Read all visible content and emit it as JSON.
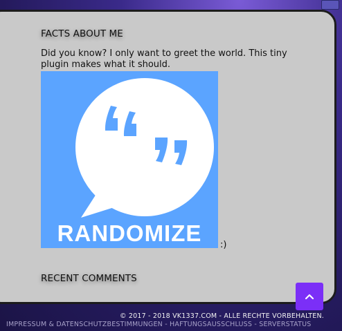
{
  "about": {
    "title": "FACTS ABOUT ME",
    "text": "Did you know? I only want to greet the world. This tiny plugin makes what it should.",
    "image_caption": "RANDOMIZE",
    "after_image": ":)"
  },
  "comments": {
    "title": "RECENT COMMENTS"
  },
  "footer": {
    "copyright": "© 2017 - 2018 VK1337.COM - ALLE RECHTE VORBEHALTEN.",
    "links": [
      "IMPRESSUM & DATENSCHUTZBESTIMMUNGEN",
      "HAFTUNGSAUSSCHLUSS",
      "SERVERSTATUS"
    ],
    "separator": " - "
  },
  "scroll_top": {
    "icon": "chevron-up-icon"
  },
  "colors": {
    "panel": "#c9c9c9",
    "accent": "#7b2ff7",
    "plugin_blue": "#5ba4ff"
  }
}
